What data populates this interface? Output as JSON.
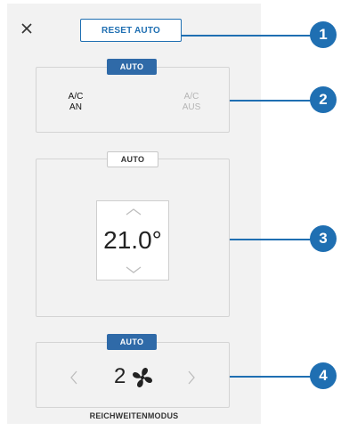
{
  "reset_label": "RESET AUTO",
  "ac": {
    "auto_label": "AUTO",
    "on": {
      "line1": "A/C",
      "line2": "AN"
    },
    "off": {
      "line1": "A/C",
      "line2": "AUS"
    }
  },
  "temperature": {
    "auto_label": "AUTO",
    "value": "21.0°"
  },
  "fan": {
    "auto_label": "AUTO",
    "speed": "2",
    "mode_label": "REICHWEITENMODUS"
  },
  "callouts": [
    "1",
    "2",
    "3",
    "4"
  ],
  "colors": {
    "accent": "#1f6fb2",
    "tag_active": "#2f6aa8",
    "panel_bg": "#f2f2f2"
  }
}
